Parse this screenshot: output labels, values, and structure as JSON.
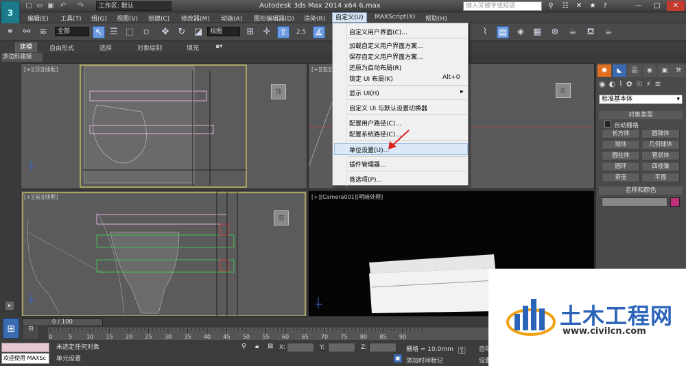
{
  "app": {
    "title": "Autodesk 3ds Max  2014 x64     6.max",
    "logo_text": "3",
    "workspace": "工作区: 默认",
    "search_placeholder": "键入关键字或短语"
  },
  "menubar": [
    "编辑(E)",
    "工具(T)",
    "组(G)",
    "视图(V)",
    "创建(C)",
    "修改器(M)",
    "动画(A)",
    "图形编辑器(D)",
    "渲染(R)",
    "自定义(U)",
    "MAXScript(X)",
    "帮助(H)"
  ],
  "toolbar": {
    "selection_filter": "全部",
    "ref_coord": "视图",
    "snap_label": "2.5"
  },
  "ribbon": {
    "tabs": [
      "建模",
      "自由形式",
      "选择",
      "对象绘制",
      "填充"
    ],
    "sub_tab": "多边形建模"
  },
  "viewports": {
    "top": "[+][顶][线框]",
    "front": "[+][前][线框]",
    "left": "[+][左][线框]",
    "camera": "[+][Camera001][明暗处理]"
  },
  "custom_menu": {
    "items": [
      "自定义用户界面(C)...",
      "加载自定义用户界面方案...",
      "保存自定义用户界面方案...",
      "还原为启动布局(R)",
      "锁定 UI 布局(K)",
      "显示 UI(H)",
      "自定义 UI 与默认设置切换器",
      "配置用户路径(C)...",
      "配置系统路径(C)...",
      "单位设置(U)...",
      "插件管理器...",
      "首选项(P)..."
    ],
    "lock_shortcut": "Alt+0",
    "highlighted": "单位设置(U)..."
  },
  "command_panel": {
    "category": "标准基本体",
    "object_type_title": "对象类型",
    "autogrid_label": "自动栅格",
    "buttons": [
      "长方体",
      "圆锥体",
      "球体",
      "几何球体",
      "圆柱体",
      "管状体",
      "圆环",
      "四棱锥",
      "茶壶",
      "平面"
    ],
    "name_color_title": "名称和颜色",
    "swatch_color": "#c0307a"
  },
  "timeline": {
    "frame_indicator": "0 / 100",
    "ticks": [
      "0",
      "5",
      "10",
      "15",
      "20",
      "25",
      "30",
      "35",
      "40",
      "45",
      "50",
      "55",
      "60",
      "65",
      "70",
      "75",
      "80",
      "85",
      "90"
    ]
  },
  "status": {
    "maxscript_label": "欢迎使用 MAXSc",
    "selection_status": "未选定任何对象",
    "prompt": "单元设置",
    "x_label": "X:",
    "y_label": "Y:",
    "z_label": "Z:",
    "grid": "栅格 = 10.0mm",
    "add_time_tag": "添加时间标记",
    "auto_key_label": "自动",
    "set_key_label": "设置"
  },
  "watermark": {
    "text": "土木工程网",
    "url": "www.civilcn.com"
  },
  "colors": {
    "highlight_blue": "#6c9be0",
    "menu_highlight": "#dbe8f7",
    "watermark_blue": "#2a63b8",
    "arrow_red": "#e02020"
  }
}
